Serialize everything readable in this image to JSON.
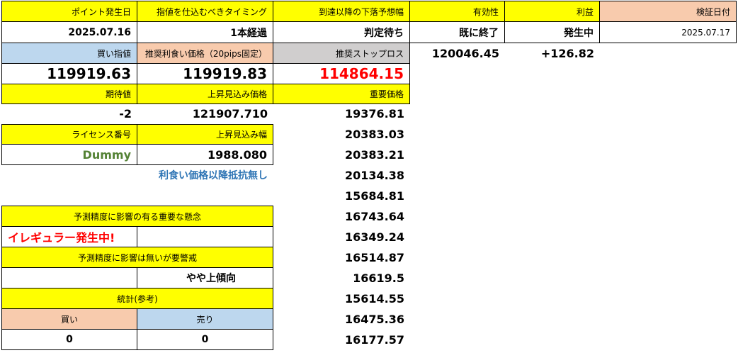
{
  "headers": {
    "issue_date_label": "ポイント発生日",
    "timing_label": "指値を仕込むべきタイミング",
    "drop_label": "到達以降の下落予想幅",
    "valid_label": "有効性",
    "profit_label": "利益",
    "verify_date_label": "検証日付"
  },
  "row1": {
    "issue_date": "2025.07.16",
    "timing": "1本経過",
    "drop": "判定待ち",
    "valid": "既に終了",
    "profit": "発生中",
    "verify_date": "2025.07.17"
  },
  "row2": {
    "buy_limit_label": "買い指値",
    "take_profit_label": "推奨利食い価格（20pips固定）",
    "stop_loss_label": "推奨ストップロス",
    "current_price": "120046.45",
    "profit_value": "+126.82"
  },
  "row3": {
    "buy_limit": "119919.63",
    "take_profit": "119919.83",
    "stop_loss": "114864.15"
  },
  "row4": {
    "expected_label": "期待値",
    "rise_price_label": "上昇見込み価格",
    "important_label": "重要価格"
  },
  "row5": {
    "expected": "-2",
    "rise_price": "121907.710"
  },
  "row6": {
    "license_label": "ライセンス番号",
    "rise_width_label": "上昇見込み幅"
  },
  "row7": {
    "license": "Dummy",
    "rise_width": "1988.080"
  },
  "note": "利食い価格以降抵抗無し",
  "concern_label": "予測精度に影響の有る重要な懸念",
  "irregular": "イレギュラー発生中!",
  "caution_label": "予測精度に影響は無いが要警戒",
  "trend": "やや上傾向",
  "stats_label": "統計(参考)",
  "buy_label": "買い",
  "sell_label": "売り",
  "buy_count": "0",
  "sell_count": "0",
  "important_prices": [
    "19376.81",
    "20383.03",
    "20383.21",
    "20134.38",
    "15684.81",
    "16743.64",
    "16349.24",
    "16514.87",
    "16619.5",
    "15614.55",
    "16475.36",
    "16177.57"
  ]
}
